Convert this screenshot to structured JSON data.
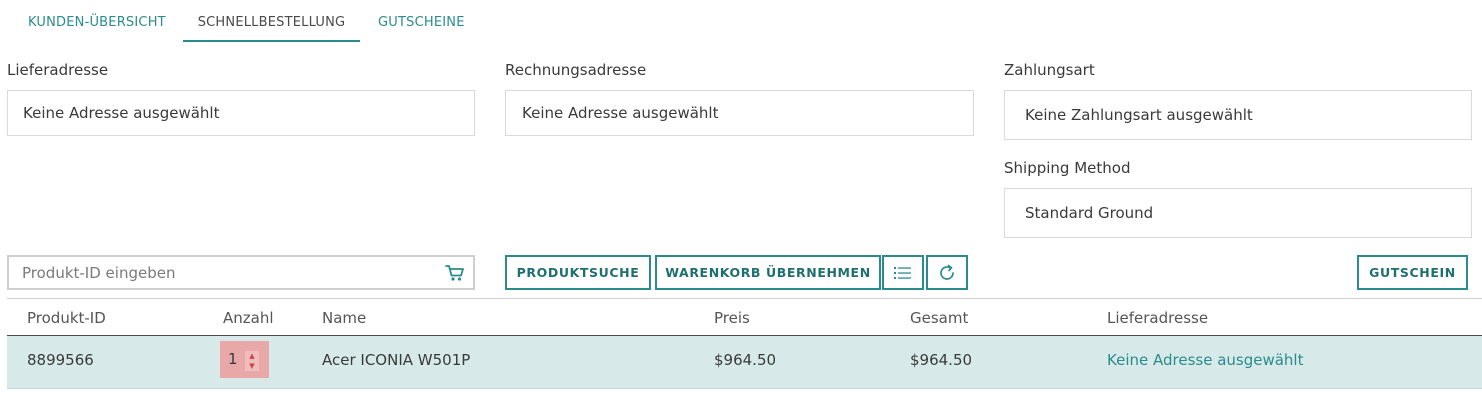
{
  "tabs": {
    "overview": "KUNDEN-ÜBERSICHT",
    "quick_order": "SCHNELLBESTELLUNG",
    "vouchers": "GUTSCHEINE"
  },
  "delivery": {
    "label": "Lieferadresse",
    "value": "Keine Adresse ausgewählt"
  },
  "billing": {
    "label": "Rechnungsadresse",
    "value": "Keine Adresse ausgewählt"
  },
  "payment": {
    "label": "Zahlungsart",
    "value": "Keine Zahlungsart ausgewählt"
  },
  "shipping": {
    "label": "Shipping Method",
    "value": "Standard Ground"
  },
  "product_input": {
    "placeholder": "Produkt-ID eingeben"
  },
  "buttons": {
    "product_search": "PRODUKTSUCHE",
    "apply_cart": "WARENKORB ÜBERNEHMEN",
    "voucher": "GUTSCHEIN"
  },
  "table": {
    "headers": [
      "Produkt-ID",
      "Anzahl",
      "Name",
      "Preis",
      "Gesamt",
      "Lieferadresse"
    ],
    "rows": [
      {
        "product_id": "8899566",
        "quantity": "1",
        "name": "Acer ICONIA W501P",
        "price": "$964.50",
        "total": "$964.50",
        "delivery": "Keine Adresse ausgewählt"
      }
    ]
  },
  "colors": {
    "accent": "#2a8c8c",
    "row_highlight": "#d7e9e9",
    "stepper_highlight": "#e8a8a8"
  },
  "icons": [
    "cart-icon",
    "list-icon",
    "refresh-icon",
    "chevron-up-icon",
    "chevron-down-icon"
  ]
}
